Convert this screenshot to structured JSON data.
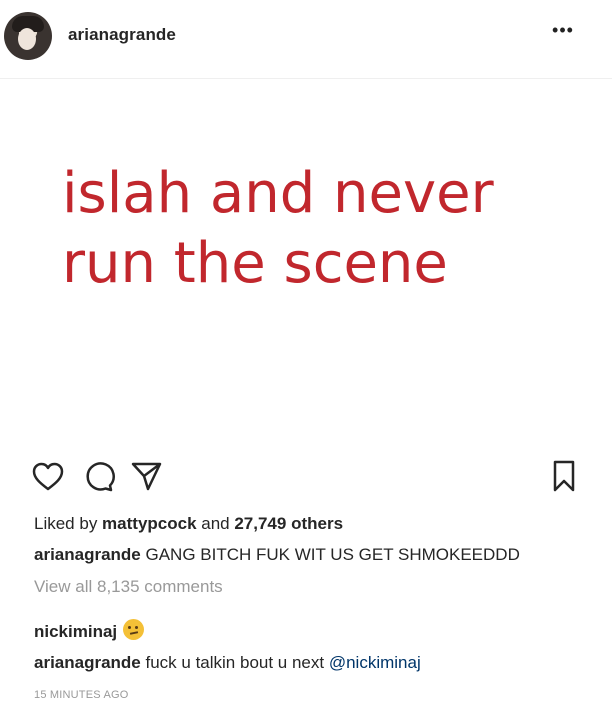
{
  "header": {
    "username": "arianagrande",
    "more_icon": "more-horizontal-icon"
  },
  "post_image": {
    "text_line_1": "islah and never",
    "text_line_2": "run the scene",
    "text_color": "#c1272d"
  },
  "actions": {
    "like_icon": "heart-outline-icon",
    "comment_icon": "comment-bubble-icon",
    "share_icon": "paper-plane-icon",
    "save_icon": "bookmark-icon"
  },
  "likes": {
    "prefix": "Liked by ",
    "user": "mattypcock",
    "middle": " and ",
    "others": "27,749 others"
  },
  "caption": {
    "user": "arianagrande",
    "text": "GANG BITCH FUK WIT US GET SHMOKEEDDD"
  },
  "view_comments": "View all 8,135 comments",
  "comments": [
    {
      "user": "nickiminaj",
      "emoji": "grimacing-face-emoji"
    },
    {
      "user": "arianagrande",
      "text": "fuck u talkin bout u next ",
      "mention": "@nickiminaj"
    }
  ],
  "timestamp": "15 MINUTES AGO"
}
